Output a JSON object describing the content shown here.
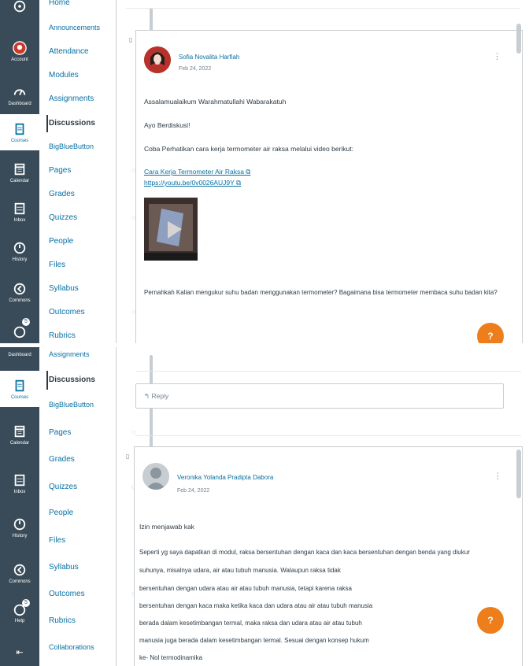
{
  "global_nav": {
    "top": [
      {
        "label": "",
        "icon": "logo-icon"
      },
      {
        "label": "Account",
        "icon": "account-icon"
      },
      {
        "label": "Dashboard",
        "icon": "dashboard-icon"
      },
      {
        "label": "Courses",
        "icon": "courses-icon"
      },
      {
        "label": "Calendar",
        "icon": "calendar-icon"
      },
      {
        "label": "Inbox",
        "icon": "inbox-icon"
      },
      {
        "label": "History",
        "icon": "history-icon"
      },
      {
        "label": "Commons",
        "icon": "commons-icon"
      },
      {
        "label": "",
        "icon": "help-icon",
        "badge": "5"
      }
    ],
    "bottom": [
      {
        "label": "Dashboard",
        "icon": "dashboard-icon"
      },
      {
        "label": "Courses",
        "icon": "courses-icon"
      },
      {
        "label": "Calendar",
        "icon": "calendar-icon"
      },
      {
        "label": "Inbox",
        "icon": "inbox-icon"
      },
      {
        "label": "History",
        "icon": "history-icon"
      },
      {
        "label": "Commons",
        "icon": "commons-icon"
      },
      {
        "label": "Help",
        "icon": "help-icon",
        "badge": "5"
      }
    ]
  },
  "course_nav": {
    "top": [
      "Home",
      "Announcements",
      "Attendance",
      "Modules",
      "Assignments",
      "Discussions",
      "BigBlueButton",
      "Pages",
      "Grades",
      "Quizzes",
      "People",
      "Files",
      "Syllabus",
      "Outcomes",
      "Rubrics"
    ],
    "bottom": [
      "Assignments",
      "Discussions",
      "BigBlueButton",
      "Pages",
      "Grades",
      "Quizzes",
      "People",
      "Files",
      "Syllabus",
      "Outcomes",
      "Rubrics",
      "Collaborations"
    ],
    "active": "Discussions"
  },
  "post1": {
    "author": "Sofia Novalita Harfiah",
    "date": "Feb 24, 2022",
    "lines": [
      "Assalamualaikum Warahmatullahi Wabarakatuh",
      "Ayo Berdiskusi!",
      "Coba Perhatikan cara kerja termometer air raksa melalui video berikut:"
    ],
    "link1": "Cara Kerja Termometer Air Raksa ⧉",
    "link2": "https://youtu.be/0v0026AUJ9Y ⧉",
    "question": "Pernahkah Kalian mengukur suhu badan menggunakan termometer? Bagaimana bisa termometer membaca suhu badan kita?"
  },
  "reply_label": "↰ Reply",
  "post2": {
    "author": "Veronika Yolanda Pradipta Dabora",
    "date": "Feb 24, 2022",
    "lines": [
      "Izin menjawab kak",
      "Seperti yg saya dapatkan di modul, raksa bersentuhan dengan kaca dan kaca bersentuhan dengan benda yang diukur",
      "suhunya, misalnya udara, air atau tubuh manusia. Walaupun raksa tidak",
      "bersentuhan dengan udara atau air atau tubuh manusia, tetapi karena raksa",
      "bersentuhan dengan kaca maka ketika kaca dan udara atau air atau tubuh manusia",
      "berada dalam kesetimbangan termal, maka raksa dan udara atau air atau tubuh",
      "manusia juga berada dalam kesetimbangan termal. Sesuai dengan konsep hukum",
      "ke- Nol termodinamika"
    ]
  },
  "help_fab": "?",
  "colors": {
    "nav_bg": "#394b58",
    "link": "#0770a3",
    "accent": "#ee7e1b",
    "text": "#2d3b45"
  }
}
